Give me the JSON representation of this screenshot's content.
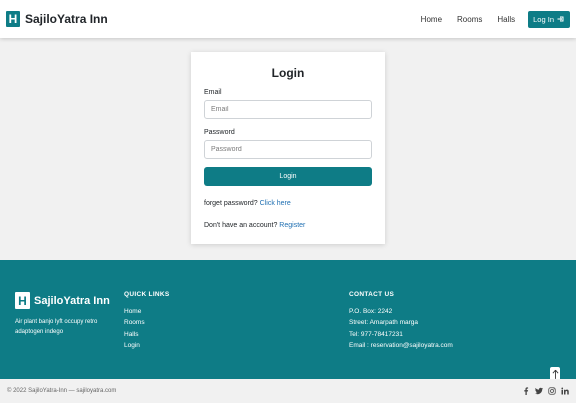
{
  "brand": {
    "logo_letter": "H",
    "name": "SajiloYatra Inn"
  },
  "nav": {
    "links": [
      "Home",
      "Rooms",
      "Halls"
    ],
    "login_label": "Log In"
  },
  "login_form": {
    "title": "Login",
    "email_label": "Email",
    "email_placeholder": "Email",
    "password_label": "Password",
    "password_placeholder": "Password",
    "submit_label": "Login",
    "forgot_text": "forget password?",
    "forgot_link": "Click here",
    "register_text": "Don't have an account?",
    "register_link": "Register"
  },
  "footer": {
    "brand_name": "SajiloYatra Inn",
    "logo_letter": "H",
    "tagline": "Air plant banjo lyft occupy retro adaptogen indego",
    "quick_links": {
      "title": "QUICK LINKS",
      "items": [
        "Home",
        "Rooms",
        "Halls",
        "Login"
      ]
    },
    "contact": {
      "title": "CONTACT US",
      "items": [
        "P.O. Box: 2242",
        "Street: Amarpath marga",
        "Tel: 977-78417231",
        "Email : reservation@sajiloyatra.com"
      ]
    },
    "copyright": "© 2022 SajiloYatra-Inn — sajiloyatra.com",
    "socials": [
      "facebook-icon",
      "twitter-icon",
      "instagram-icon",
      "linkedin-icon"
    ]
  },
  "colors": {
    "primary": "#0e7c86",
    "page_bg": "#f1f1f1",
    "link": "#1f6fb2"
  }
}
